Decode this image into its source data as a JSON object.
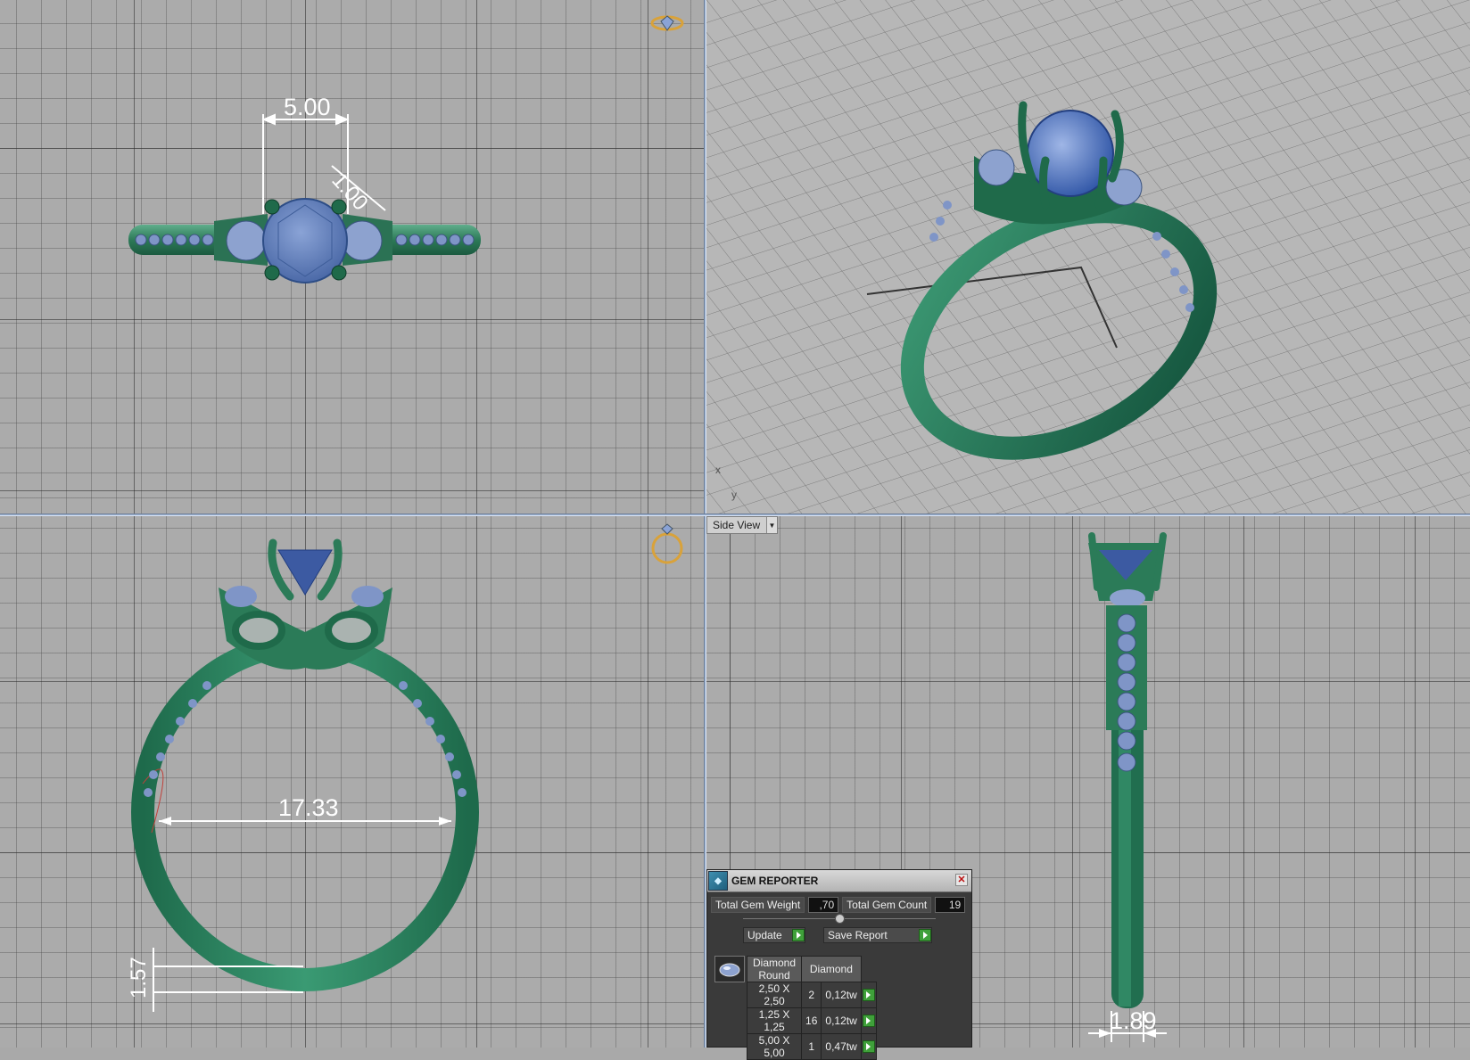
{
  "top_view": {
    "dim_width": "5.00",
    "dim_prong": "1.00"
  },
  "front_view": {
    "dim_inner": "17.33",
    "dim_band": "1.57"
  },
  "perspective_view": {
    "axis_x": "x",
    "axis_y": "y"
  },
  "side_view": {
    "view_label": "Side View",
    "dim_band_width": "1.89"
  },
  "gem_reporter": {
    "title": "GEM REPORTER",
    "total_weight_label": "Total Gem Weight",
    "total_weight_value": ",70",
    "total_count_label": "Total Gem Count",
    "total_count_value": "19",
    "update_label": "Update",
    "save_report_label": "Save Report",
    "table": {
      "headers": [
        "Diamond Round",
        "",
        "Diamond"
      ],
      "rows": [
        {
          "size": "2,50 X 2,50",
          "count": "2",
          "weight": "0,12tw"
        },
        {
          "size": "1,25 X 1,25",
          "count": "16",
          "weight": "0,12tw"
        },
        {
          "size": "5,00 X 5,00",
          "count": "1",
          "weight": "0,47tw"
        }
      ]
    }
  },
  "colors": {
    "metal": "#2e7a5c",
    "gem": "#6b86c0",
    "divider": "#9db3d2",
    "grid_bg": "#ababab"
  }
}
